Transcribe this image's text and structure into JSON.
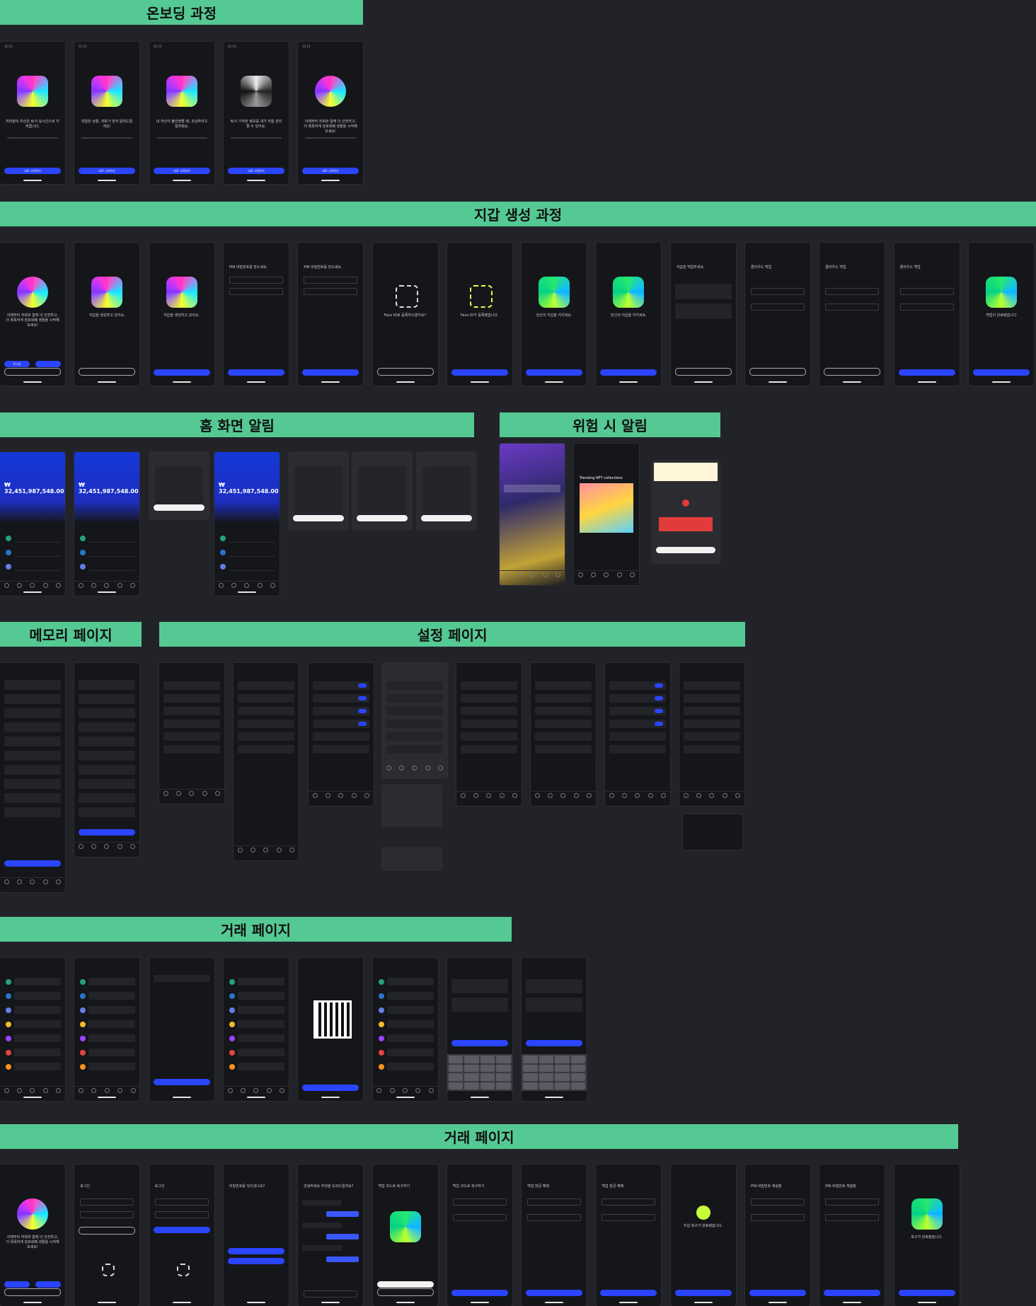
{
  "sections": {
    "onboarding": "온보딩 과정",
    "wallet_create": "지갑 생성 과정",
    "home_alert": "홈 화면 알림",
    "danger_alert": "위험 시 알림",
    "memory": "메모리 페이지",
    "settings": "설정 페이지",
    "trade": "거래 페이지",
    "trade2": "거래 페이지"
  },
  "onboarding_screens": [
    {
      "time": "11:11",
      "text": "여러분의 자산은 AI가 실시간으로 지켜줍니다.",
      "button": "바로 시작하기"
    },
    {
      "time": "11:11",
      "text": "위험한 상황, 저희가 먼저 알려드릴게요!",
      "button": "바로 시작하기"
    },
    {
      "time": "11:11",
      "text": "내 자산이 불안정할 때, 조심하라고 알려줘요.",
      "button": "바로 시작하기"
    },
    {
      "time": "11:11",
      "text": "AI가 기억한 정보를 내가 직접 관리할 수 있어요.",
      "button": "바로 시작하기"
    },
    {
      "time": "11:11",
      "text": "이제부터 저희와 함께 더 안전하고, 더 똑똑하게 암호화폐 생활을 시작해보세요!",
      "button": "바로 시작하기"
    }
  ],
  "wallet_screens": [
    {
      "text": "이제부터 저희와 함께 더 안전하고, 더 똑똑하게 암호화폐 생활을 시작해보세요!",
      "button": "로그인"
    },
    {
      "text": "지갑을 생성하고 있어요.",
      "button": ""
    },
    {
      "text": "지갑을 생성하고 있어요.",
      "button": ""
    },
    {
      "text": "PIN 비밀번호를 만드세요.",
      "button": ""
    },
    {
      "text": "PIN 비밀번호를 만드세요.",
      "button": ""
    },
    {
      "text": "Face ID로 등록하시겠어요?",
      "button": ""
    },
    {
      "text": "Face ID가 등록됐습니다.",
      "button": ""
    },
    {
      "text": "당신의 지갑을 지키세요.",
      "button": ""
    },
    {
      "text": "당신의 지갑을 지키세요.",
      "button": ""
    },
    {
      "text": "지갑을 백업하세요.",
      "button": ""
    },
    {
      "text": "클라우드 백업",
      "button": ""
    },
    {
      "text": "클라우드 백업",
      "button": ""
    },
    {
      "text": "클라우드 백업",
      "button": ""
    },
    {
      "text": "백업이 완료됐습니다",
      "button": ""
    }
  ],
  "home_screens": [
    {
      "balance": "₩ 32,451,987,548.00"
    },
    {
      "balance": "₩ 32,451,987,548.00"
    },
    {
      "balance": ""
    },
    {
      "balance": "₩ 32,451,987,548.00"
    },
    {
      "balance": ""
    },
    {
      "balance": ""
    },
    {
      "balance": ""
    }
  ],
  "danger_screens": [
    {
      "label": "gradient"
    },
    {
      "label": "Trending NFT collections"
    },
    {
      "label": "alert"
    }
  ],
  "trade_screens_count": 8,
  "trade2_screens": [
    {
      "text": "이제부터 저희와 함께 더 안전하고, 더 똑똑하게 암호화폐 생활을 시작해보세요!"
    },
    {
      "text": "로그인"
    },
    {
      "text": "로그인"
    },
    {
      "text": "비밀번호를 잊으셨나요?"
    },
    {
      "text": "안녕하세요 무엇을 도와드릴까요?"
    },
    {
      "text": "백업 코드로 복구하기"
    },
    {
      "text": "백업 코드로 복구하기"
    },
    {
      "text": "백업 잠금 해제"
    },
    {
      "text": "백업 잠금 해제"
    },
    {
      "text": "지갑 복구가 완료됐습니다."
    },
    {
      "text": "PIN 비밀번호 재설정"
    },
    {
      "text": "PIN 비밀번호 재설정"
    },
    {
      "text": "복구가 완료됐습니다."
    }
  ]
}
